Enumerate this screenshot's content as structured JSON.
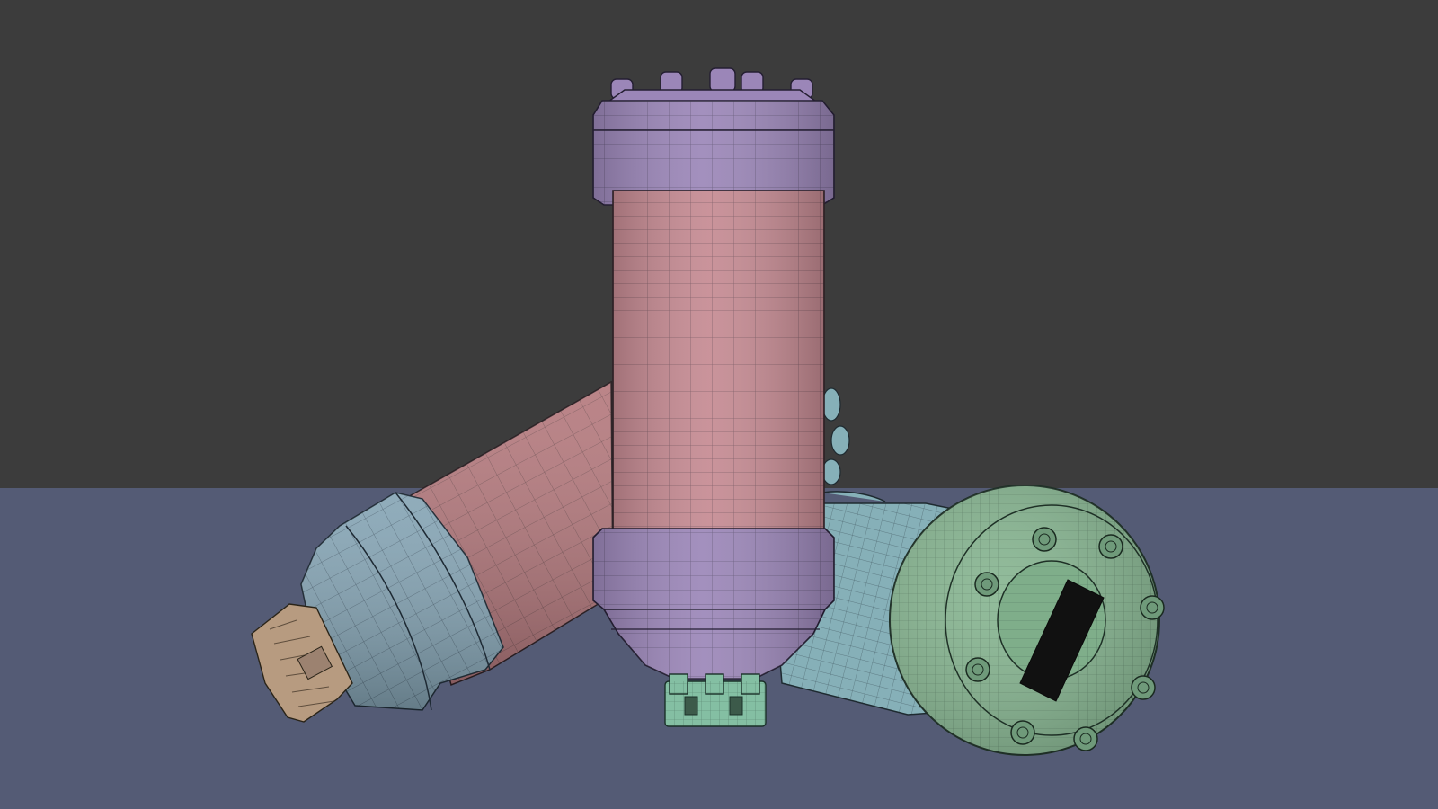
{
  "scene": {
    "background_color": "#3c3c3c",
    "floor_color": "#545b75",
    "wire_color": "#1e2530",
    "objects": [
      {
        "name": "lying-canister-left",
        "colors": {
          "body": "#b57a7e",
          "cap": "#86a5b5",
          "tip": "#b79b80"
        }
      },
      {
        "name": "standing-canister-center",
        "colors": {
          "body": "#c58a92",
          "cap": "#9b86b8",
          "base": "#84bfa3"
        }
      },
      {
        "name": "lying-canister-right",
        "colors": {
          "body": "#86b0b8",
          "end_cap": "#88b692",
          "slot": "#111111"
        }
      }
    ]
  }
}
